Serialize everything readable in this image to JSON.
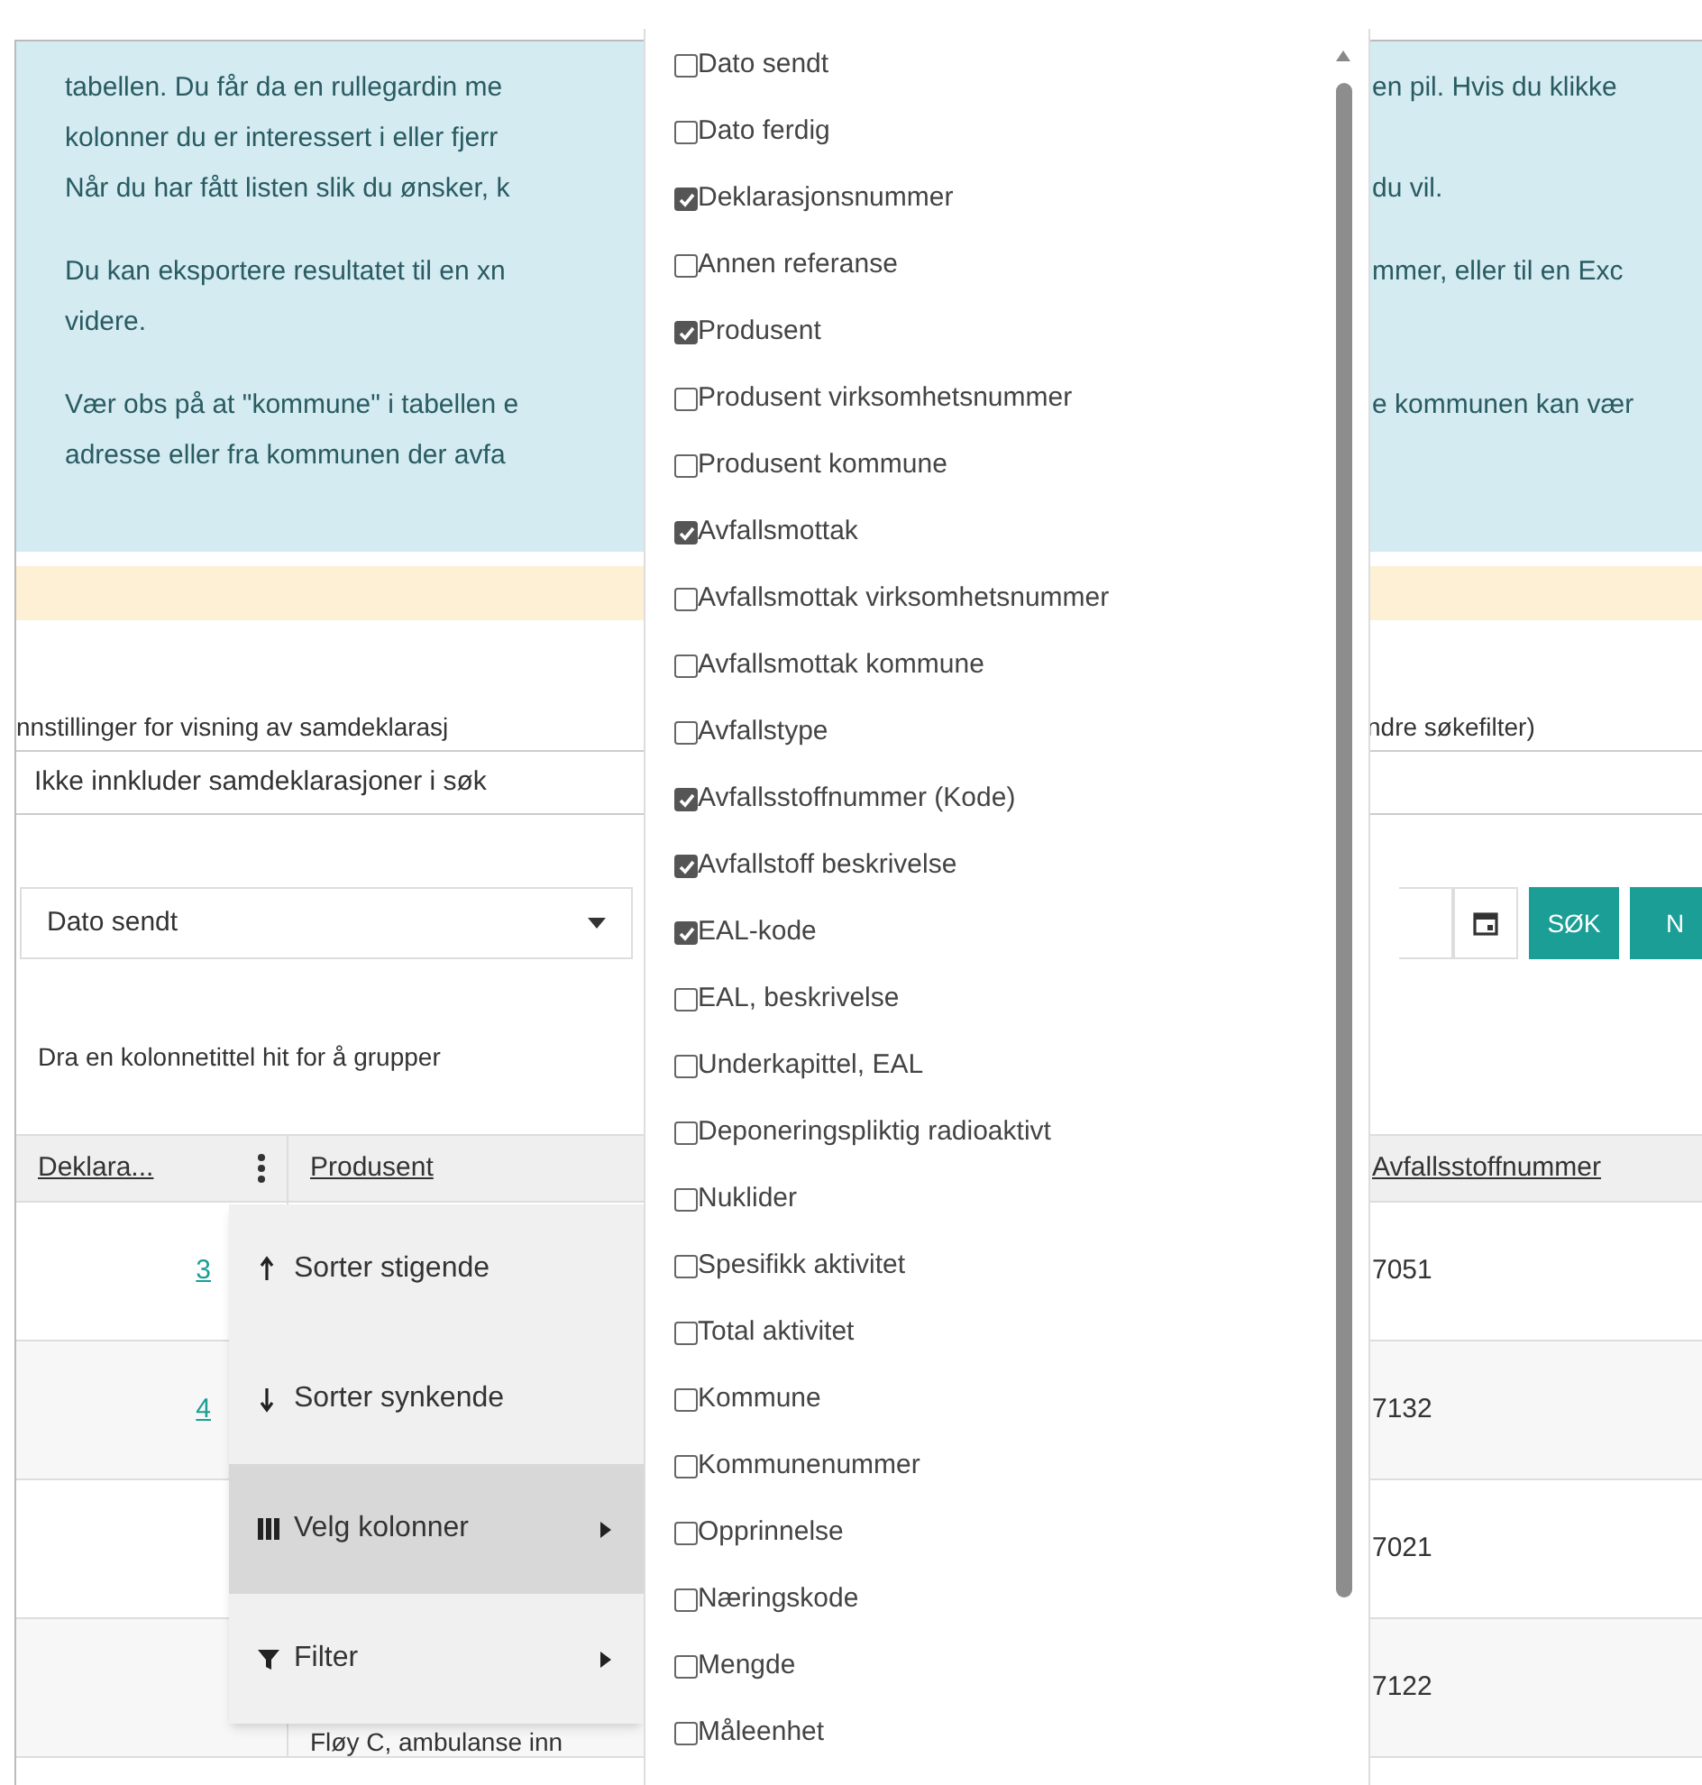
{
  "info_box": {
    "paragraphs": [
      [
        {
          "left": "tabellen. Du får da en rullegardin me",
          "right": "en pil. Hvis du klikke"
        },
        {
          "left": "kolonner du er interessert i eller fjerr"
        },
        {
          "left": "Når du har fått listen slik du ønsker, k",
          "right": "du vil."
        }
      ],
      [
        {
          "left": "Du kan eksportere resultatet til en xn",
          "right": "mmer, eller til en Exc"
        },
        {
          "left": "videre."
        }
      ],
      [
        {
          "left": "Vær obs på at \"kommune\" i tabellen e",
          "right": "e kommunen kan vær"
        },
        {
          "left": "adresse eller fra kommunen der avfa"
        }
      ]
    ]
  },
  "settings": {
    "label_left": "nnstillinger for visning av samdeklarasj",
    "label_right": "ndre søkefilter)",
    "select_value": "Ikke innkluder samdeklarasjoner i søk"
  },
  "filter": {
    "date_field": "Dato sendt",
    "search_button": "SØK",
    "second_button": "N"
  },
  "group_hint": "Dra en kolonnetittel hit for å grupper",
  "table": {
    "columns": [
      "Deklara...",
      "Produsent",
      "Avfallsstoffnummer"
    ],
    "rows": [
      {
        "column_1": "3",
        "code": "7051"
      },
      {
        "column_1": "4",
        "code": "7132"
      },
      {
        "code": "7021"
      },
      {
        "produsent": "Fløy C, ambulanse inn",
        "code": "7122"
      }
    ]
  },
  "context_menu": {
    "items": [
      {
        "label": "Sorter stigende",
        "kind": "sort-up",
        "submenu": false,
        "selected": false
      },
      {
        "label": "Sorter synkende",
        "kind": "sort-down",
        "submenu": false,
        "selected": false
      },
      {
        "label": "Velg kolonner",
        "kind": "columns",
        "submenu": true,
        "selected": true
      },
      {
        "label": "Filter",
        "kind": "filter",
        "submenu": true,
        "selected": false
      }
    ]
  },
  "column_picker": {
    "items": [
      {
        "label": "Dato sendt",
        "checked": false
      },
      {
        "label": "Dato ferdig",
        "checked": false
      },
      {
        "label": "Deklarasjonsnummer",
        "checked": true
      },
      {
        "label": "Annen referanse",
        "checked": false
      },
      {
        "label": "Produsent",
        "checked": true
      },
      {
        "label": "Produsent virksomhetsnummer",
        "checked": false
      },
      {
        "label": "Produsent kommune",
        "checked": false
      },
      {
        "label": "Avfallsmottak",
        "checked": true
      },
      {
        "label": "Avfallsmottak virksomhetsnummer",
        "checked": false
      },
      {
        "label": "Avfallsmottak kommune",
        "checked": false
      },
      {
        "label": "Avfallstype",
        "checked": false
      },
      {
        "label": "Avfallsstoffnummer (Kode)",
        "checked": true
      },
      {
        "label": "Avfallstoff beskrivelse",
        "checked": true
      },
      {
        "label": "EAL-kode",
        "checked": true
      },
      {
        "label": "EAL, beskrivelse",
        "checked": false
      },
      {
        "label": "Underkapittel, EAL",
        "checked": false
      },
      {
        "label": "Deponeringspliktig radioaktivt",
        "checked": false
      },
      {
        "label": "Nuklider",
        "checked": false
      },
      {
        "label": "Spesifikk aktivitet",
        "checked": false
      },
      {
        "label": "Total aktivitet",
        "checked": false
      },
      {
        "label": "Kommune",
        "checked": false
      },
      {
        "label": "Kommunenummer",
        "checked": false
      },
      {
        "label": "Opprinnelse",
        "checked": false
      },
      {
        "label": "Næringskode",
        "checked": false
      },
      {
        "label": "Mengde",
        "checked": false
      },
      {
        "label": "Måleenhet",
        "checked": false
      }
    ]
  }
}
